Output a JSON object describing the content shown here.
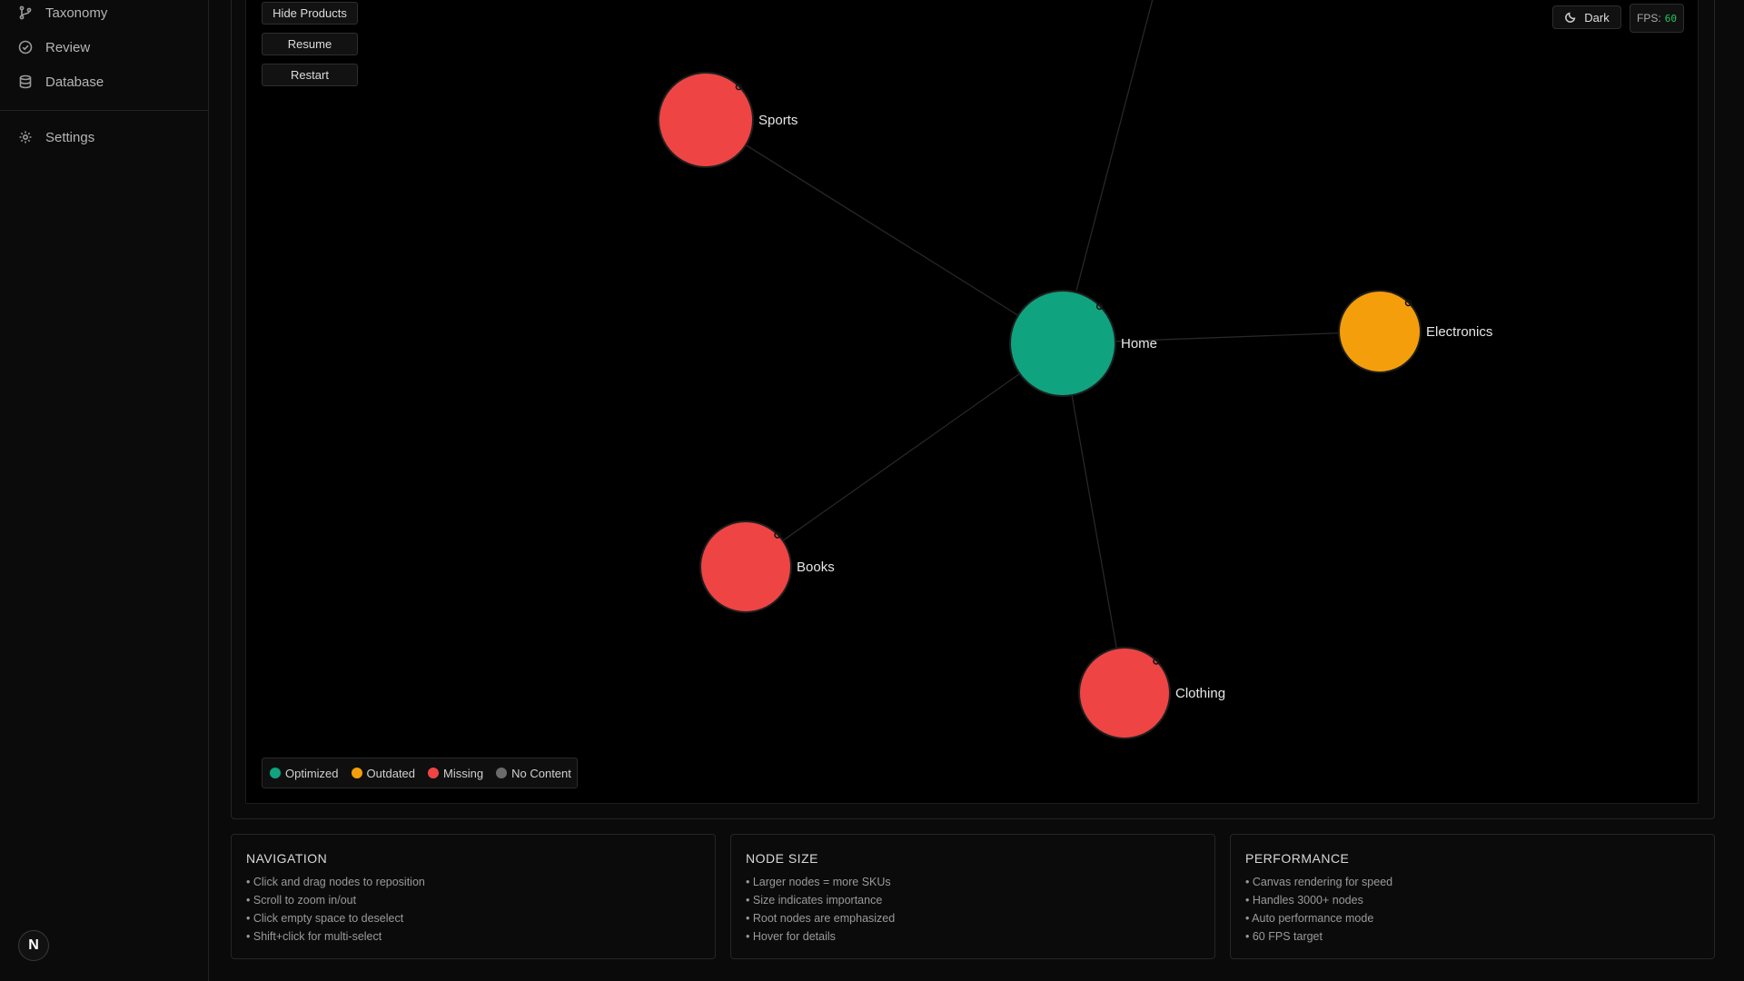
{
  "sidebar": {
    "items": [
      {
        "label": "Taxonomy",
        "icon": "git-branch-icon"
      },
      {
        "label": "Review",
        "icon": "check-circle-icon"
      },
      {
        "label": "Database",
        "icon": "database-icon"
      },
      {
        "label": "Settings",
        "icon": "gear-icon"
      }
    ],
    "avatar": "N"
  },
  "controls": {
    "hide_products": "Hide Products",
    "resume": "Resume",
    "restart": "Restart"
  },
  "toolbar": {
    "theme_label": "Dark",
    "fps_label": "FPS:",
    "fps_value": "60"
  },
  "graph": {
    "nodes": [
      {
        "id": "home",
        "label": "Home",
        "status": "optimized",
        "root": true
      },
      {
        "id": "sports",
        "label": "Sports",
        "status": "missing"
      },
      {
        "id": "electronics",
        "label": "Electronics",
        "status": "outdated"
      },
      {
        "id": "books",
        "label": "Books",
        "status": "missing"
      },
      {
        "id": "clothing",
        "label": "Clothing",
        "status": "missing"
      }
    ],
    "edges": [
      [
        "home",
        "sports"
      ],
      [
        "home",
        "electronics"
      ],
      [
        "home",
        "books"
      ],
      [
        "home",
        "clothing"
      ]
    ]
  },
  "colors": {
    "optimized": "#10a37f",
    "outdated": "#f59e0b",
    "missing": "#ef4444",
    "no_content": "#6b6b6b"
  },
  "legend": {
    "optimized": "Optimized",
    "outdated": "Outdated",
    "missing": "Missing",
    "no_content": "No Content"
  },
  "cards": [
    {
      "title": "NAVIGATION",
      "items": [
        "Click and drag nodes to reposition",
        "Scroll to zoom in/out",
        "Click empty space to deselect",
        "Shift+click for multi-select"
      ]
    },
    {
      "title": "NODE SIZE",
      "items": [
        "Larger nodes = more SKUs",
        "Size indicates importance",
        "Root nodes are emphasized",
        "Hover for details"
      ]
    },
    {
      "title": "PERFORMANCE",
      "items": [
        "Canvas rendering for speed",
        "Handles 3000+ nodes",
        "Auto performance mode",
        "60 FPS target"
      ]
    }
  ]
}
